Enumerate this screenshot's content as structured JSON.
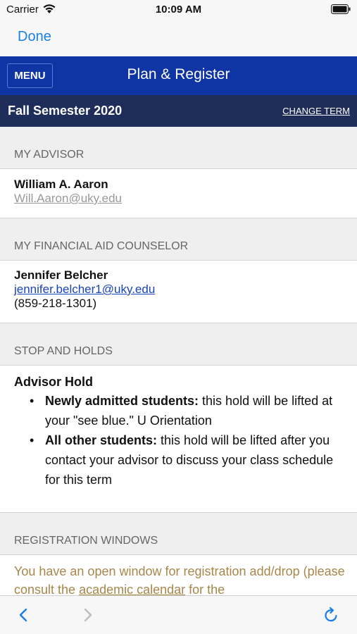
{
  "status_bar": {
    "carrier": "Carrier",
    "time": "10:09 AM",
    "icons": [
      "wifi-icon",
      "battery-icon"
    ]
  },
  "browser": {
    "done_label": "Done"
  },
  "header": {
    "menu_label": "MENU",
    "title": "Plan & Register"
  },
  "term": {
    "title": "Fall Semester 2020",
    "change_label": "CHANGE TERM"
  },
  "advisor": {
    "heading": "MY ADVISOR",
    "name": "William A. Aaron",
    "email": "Will.Aaron@uky.edu"
  },
  "financial_aid": {
    "heading": "MY FINANCIAL AID COUNSELOR",
    "name": "Jennifer Belcher",
    "email": "jennifer.belcher1@uky.edu",
    "phone": "(859-218-1301)"
  },
  "holds": {
    "heading": "STOP AND HOLDS",
    "title": "Advisor Hold",
    "items": [
      {
        "bold": "Newly admitted students:",
        "text": " this hold will be lifted at your \"see blue.\" U Orientation"
      },
      {
        "bold": "All other students:",
        "text": " this hold will be lifted after you contact your advisor to discuss your class schedule for this term"
      }
    ]
  },
  "registration": {
    "heading": "REGISTRATION WINDOWS",
    "text_before": "You have an open window for registration add/drop (please consult the ",
    "link": "academic calendar",
    "text_after": " for the"
  },
  "toolbar": {
    "icons": [
      "back-icon",
      "forward-icon",
      "refresh-icon"
    ]
  },
  "colors": {
    "header_blue": "#0f35a5",
    "term_navy": "#1f2d5a",
    "ios_blue": "#1a7ee8",
    "registration_text": "#a8864a"
  }
}
